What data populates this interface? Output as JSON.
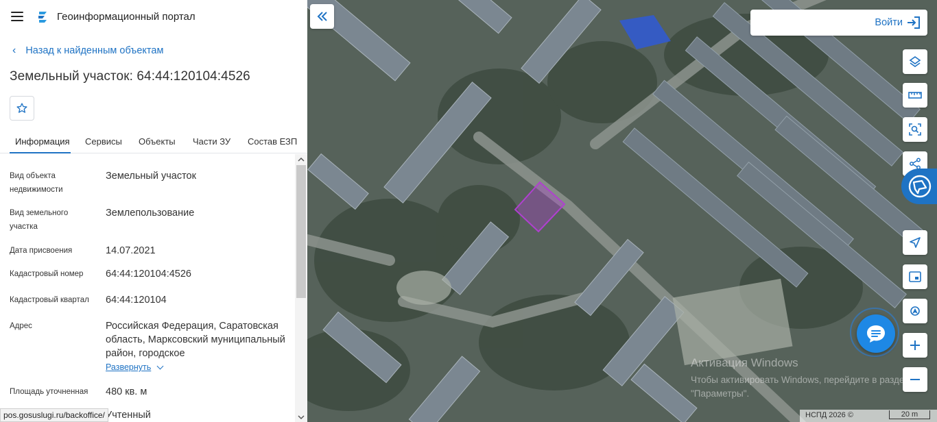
{
  "header": {
    "title": "Геоинформационный портал",
    "menu_icon": "hamburger-icon",
    "logo_icon": "portal-logo-icon"
  },
  "back_link": "Назад к найденным объектам",
  "object_title": "Земельный участок: 64:44:120104:4526",
  "favorite_icon": "star-icon",
  "tabs": [
    {
      "label": "Информация",
      "active": true
    },
    {
      "label": "Сервисы",
      "active": false
    },
    {
      "label": "Объекты",
      "active": false
    },
    {
      "label": "Части ЗУ",
      "active": false
    },
    {
      "label": "Состав ЕЗП",
      "active": false
    }
  ],
  "info": [
    {
      "label": "Вид объекта недвижимости",
      "value": "Земельный участок"
    },
    {
      "label": "Вид земельного участка",
      "value": "Землепользование"
    },
    {
      "label": "Дата присвоения",
      "value": "14.07.2021"
    },
    {
      "label": "Кадастровый номер",
      "value": "64:44:120104:4526"
    },
    {
      "label": "Кадастровый квартал",
      "value": "64:44:120104"
    },
    {
      "label": "Адрес",
      "value": "Российская Федерация, Саратовская область, Марксовский муниципальный район, городское"
    },
    {
      "label": "Площадь уточненная",
      "value": "480 кв. м"
    },
    {
      "label": "",
      "value": "Учтенный"
    }
  ],
  "expand_label": "Развернуть",
  "status_url": "pos.gosuslugi.ru/backoffice/",
  "map": {
    "login_label": "Войти",
    "tools": [
      "layers-icon",
      "ruler-icon",
      "area-select-icon",
      "share-icon",
      "navigate-icon",
      "minimap-icon",
      "location-icon",
      "zoom-in-icon",
      "zoom-out-icon"
    ],
    "watermark_title": "Активация Windows",
    "watermark_text": "Чтобы активировать Windows, перейдите в раздел \"Параметры\".",
    "attribution": "НСПД 2026 ©",
    "scale_label": "20 m",
    "parcel_color": "#b040d0",
    "accent_color": "#1f73c4"
  }
}
